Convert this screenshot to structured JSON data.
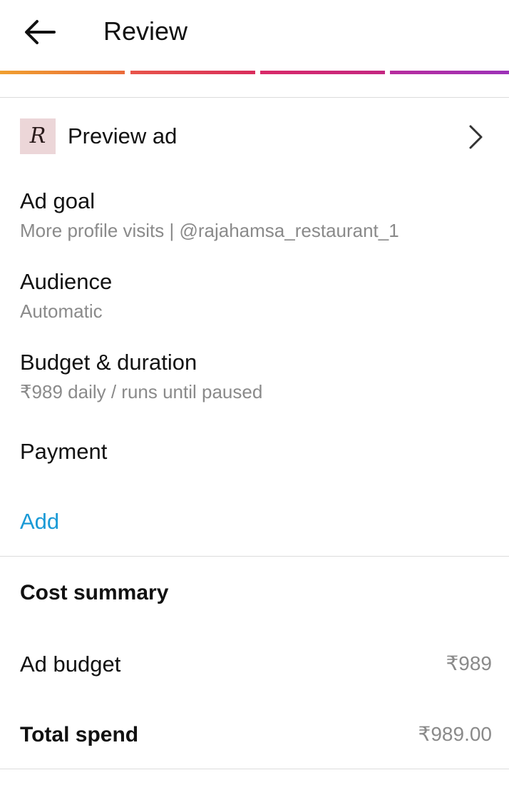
{
  "header": {
    "title": "Review"
  },
  "progress": {
    "steps_total": 4,
    "steps_completed": 4,
    "colors": [
      "#ea6a3a",
      "#d92d5c",
      "#c42782",
      "#9d32b8"
    ]
  },
  "preview": {
    "thumbnail_letter": "R",
    "label": "Preview ad",
    "icons": [
      "back-arrow-icon",
      "chevron-right-icon"
    ]
  },
  "ad_goal": {
    "title": "Ad goal",
    "value": "More profile visits | @rajahamsa_restaurant_1"
  },
  "audience": {
    "title": "Audience",
    "value": "Automatic"
  },
  "budget": {
    "title": "Budget & duration",
    "value": "₹989 daily / runs until paused"
  },
  "payment": {
    "title": "Payment",
    "add_label": "Add"
  },
  "cost_summary": {
    "title": "Cost summary",
    "ad_budget_label": "Ad budget",
    "ad_budget_value": "₹989",
    "total_label": "Total spend",
    "total_value": "₹989.00"
  },
  "colors": {
    "link": "#1a9ad6",
    "secondary_text": "#8a8a8a"
  }
}
